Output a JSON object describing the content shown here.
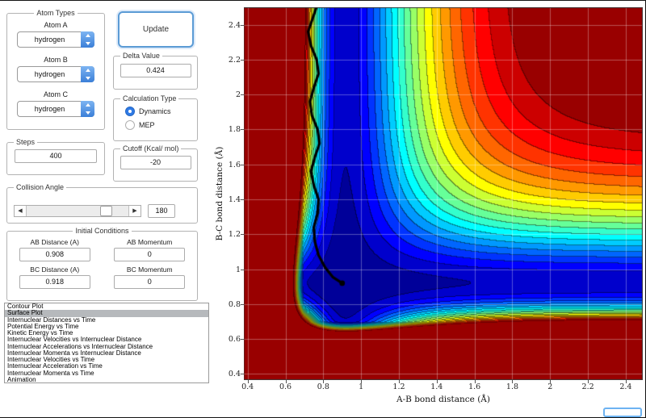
{
  "panels": {
    "atom_types": {
      "title": "Atom Types",
      "fields": [
        {
          "label": "Atom A",
          "value": "hydrogen"
        },
        {
          "label": "Atom B",
          "value": "hydrogen"
        },
        {
          "label": "Atom C",
          "value": "hydrogen"
        }
      ]
    },
    "update_button": "Update",
    "delta": {
      "title": "Delta Value",
      "value": "0.424"
    },
    "calculation_type": {
      "title": "Calculation Type",
      "options": [
        {
          "label": "Dynamics",
          "selected": true
        },
        {
          "label": "MEP",
          "selected": false
        }
      ]
    },
    "steps": {
      "title": "Steps",
      "value": "400"
    },
    "cutoff": {
      "title": "Cutoff (Kcal/ mol)",
      "value": "-20"
    },
    "collision_angle": {
      "title": "Collision Angle",
      "value": "180"
    },
    "initial_conditions": {
      "title": "Initial Conditions",
      "fields": [
        {
          "label": "AB Distance (A)",
          "value": "0.908"
        },
        {
          "label": "AB Momentum",
          "value": "0"
        },
        {
          "label": "BC Distance (A)",
          "value": "0.918"
        },
        {
          "label": "BC Momentum",
          "value": "0"
        }
      ]
    },
    "plot_list": {
      "selected_index": 1,
      "items": [
        "Contour Plot",
        "Surface Plot",
        "Internuclear Distances vs Time",
        "Potential Energy vs Time",
        "Kinetic Energy vs Time",
        "Internuclear Velocities vs Internuclear Distance",
        "Internuclear Accelerations vs Internuclear Distance",
        "Internuclear Momenta vs Internuclear Distance",
        "Internuclear Velocities vs Time",
        "Internuclear Acceleration vs Time",
        "Internuclear Momenta vs Time",
        "Animation"
      ]
    },
    "mini_field": {
      "value": ""
    }
  },
  "chart_data": {
    "type": "heatmap",
    "subtype": "filled-contour-potential-energy-surface",
    "title": "",
    "xlabel": "A-B bond distance (Å)",
    "ylabel": "B-C bond distance (Å)",
    "xlim": [
      0.38,
      2.49
    ],
    "ylim": [
      0.365,
      2.5
    ],
    "xticks": [
      0.4,
      0.6,
      0.8,
      1,
      1.2,
      1.4,
      1.6,
      1.8,
      2,
      2.2,
      2.4
    ],
    "yticks": [
      0.4,
      0.6,
      0.8,
      1,
      1.2,
      1.4,
      1.6,
      1.8,
      2,
      2.2,
      2.4
    ],
    "grid": true,
    "box": true,
    "colormap": "jet",
    "levels": 20,
    "surface": {
      "model": "morse-sum-LEPS-approx",
      "re": 0.92,
      "a": 3.1,
      "coupling": 0.95,
      "vmin": -1.06,
      "vmax": -0.1
    },
    "trajectory": {
      "color": "#000000",
      "line_width": 3.2,
      "end_marker": true,
      "points": [
        [
          0.77,
          2.52
        ],
        [
          0.745,
          2.44
        ],
        [
          0.72,
          2.36
        ],
        [
          0.735,
          2.28
        ],
        [
          0.765,
          2.2
        ],
        [
          0.775,
          2.12
        ],
        [
          0.75,
          2.04
        ],
        [
          0.73,
          1.96
        ],
        [
          0.74,
          1.88
        ],
        [
          0.77,
          1.8
        ],
        [
          0.78,
          1.72
        ],
        [
          0.755,
          1.64
        ],
        [
          0.735,
          1.56
        ],
        [
          0.75,
          1.48
        ],
        [
          0.775,
          1.4
        ],
        [
          0.77,
          1.32
        ],
        [
          0.75,
          1.24
        ],
        [
          0.755,
          1.16
        ],
        [
          0.775,
          1.08
        ],
        [
          0.81,
          1.01
        ],
        [
          0.85,
          0.955
        ],
        [
          0.9,
          0.92
        ]
      ]
    }
  }
}
